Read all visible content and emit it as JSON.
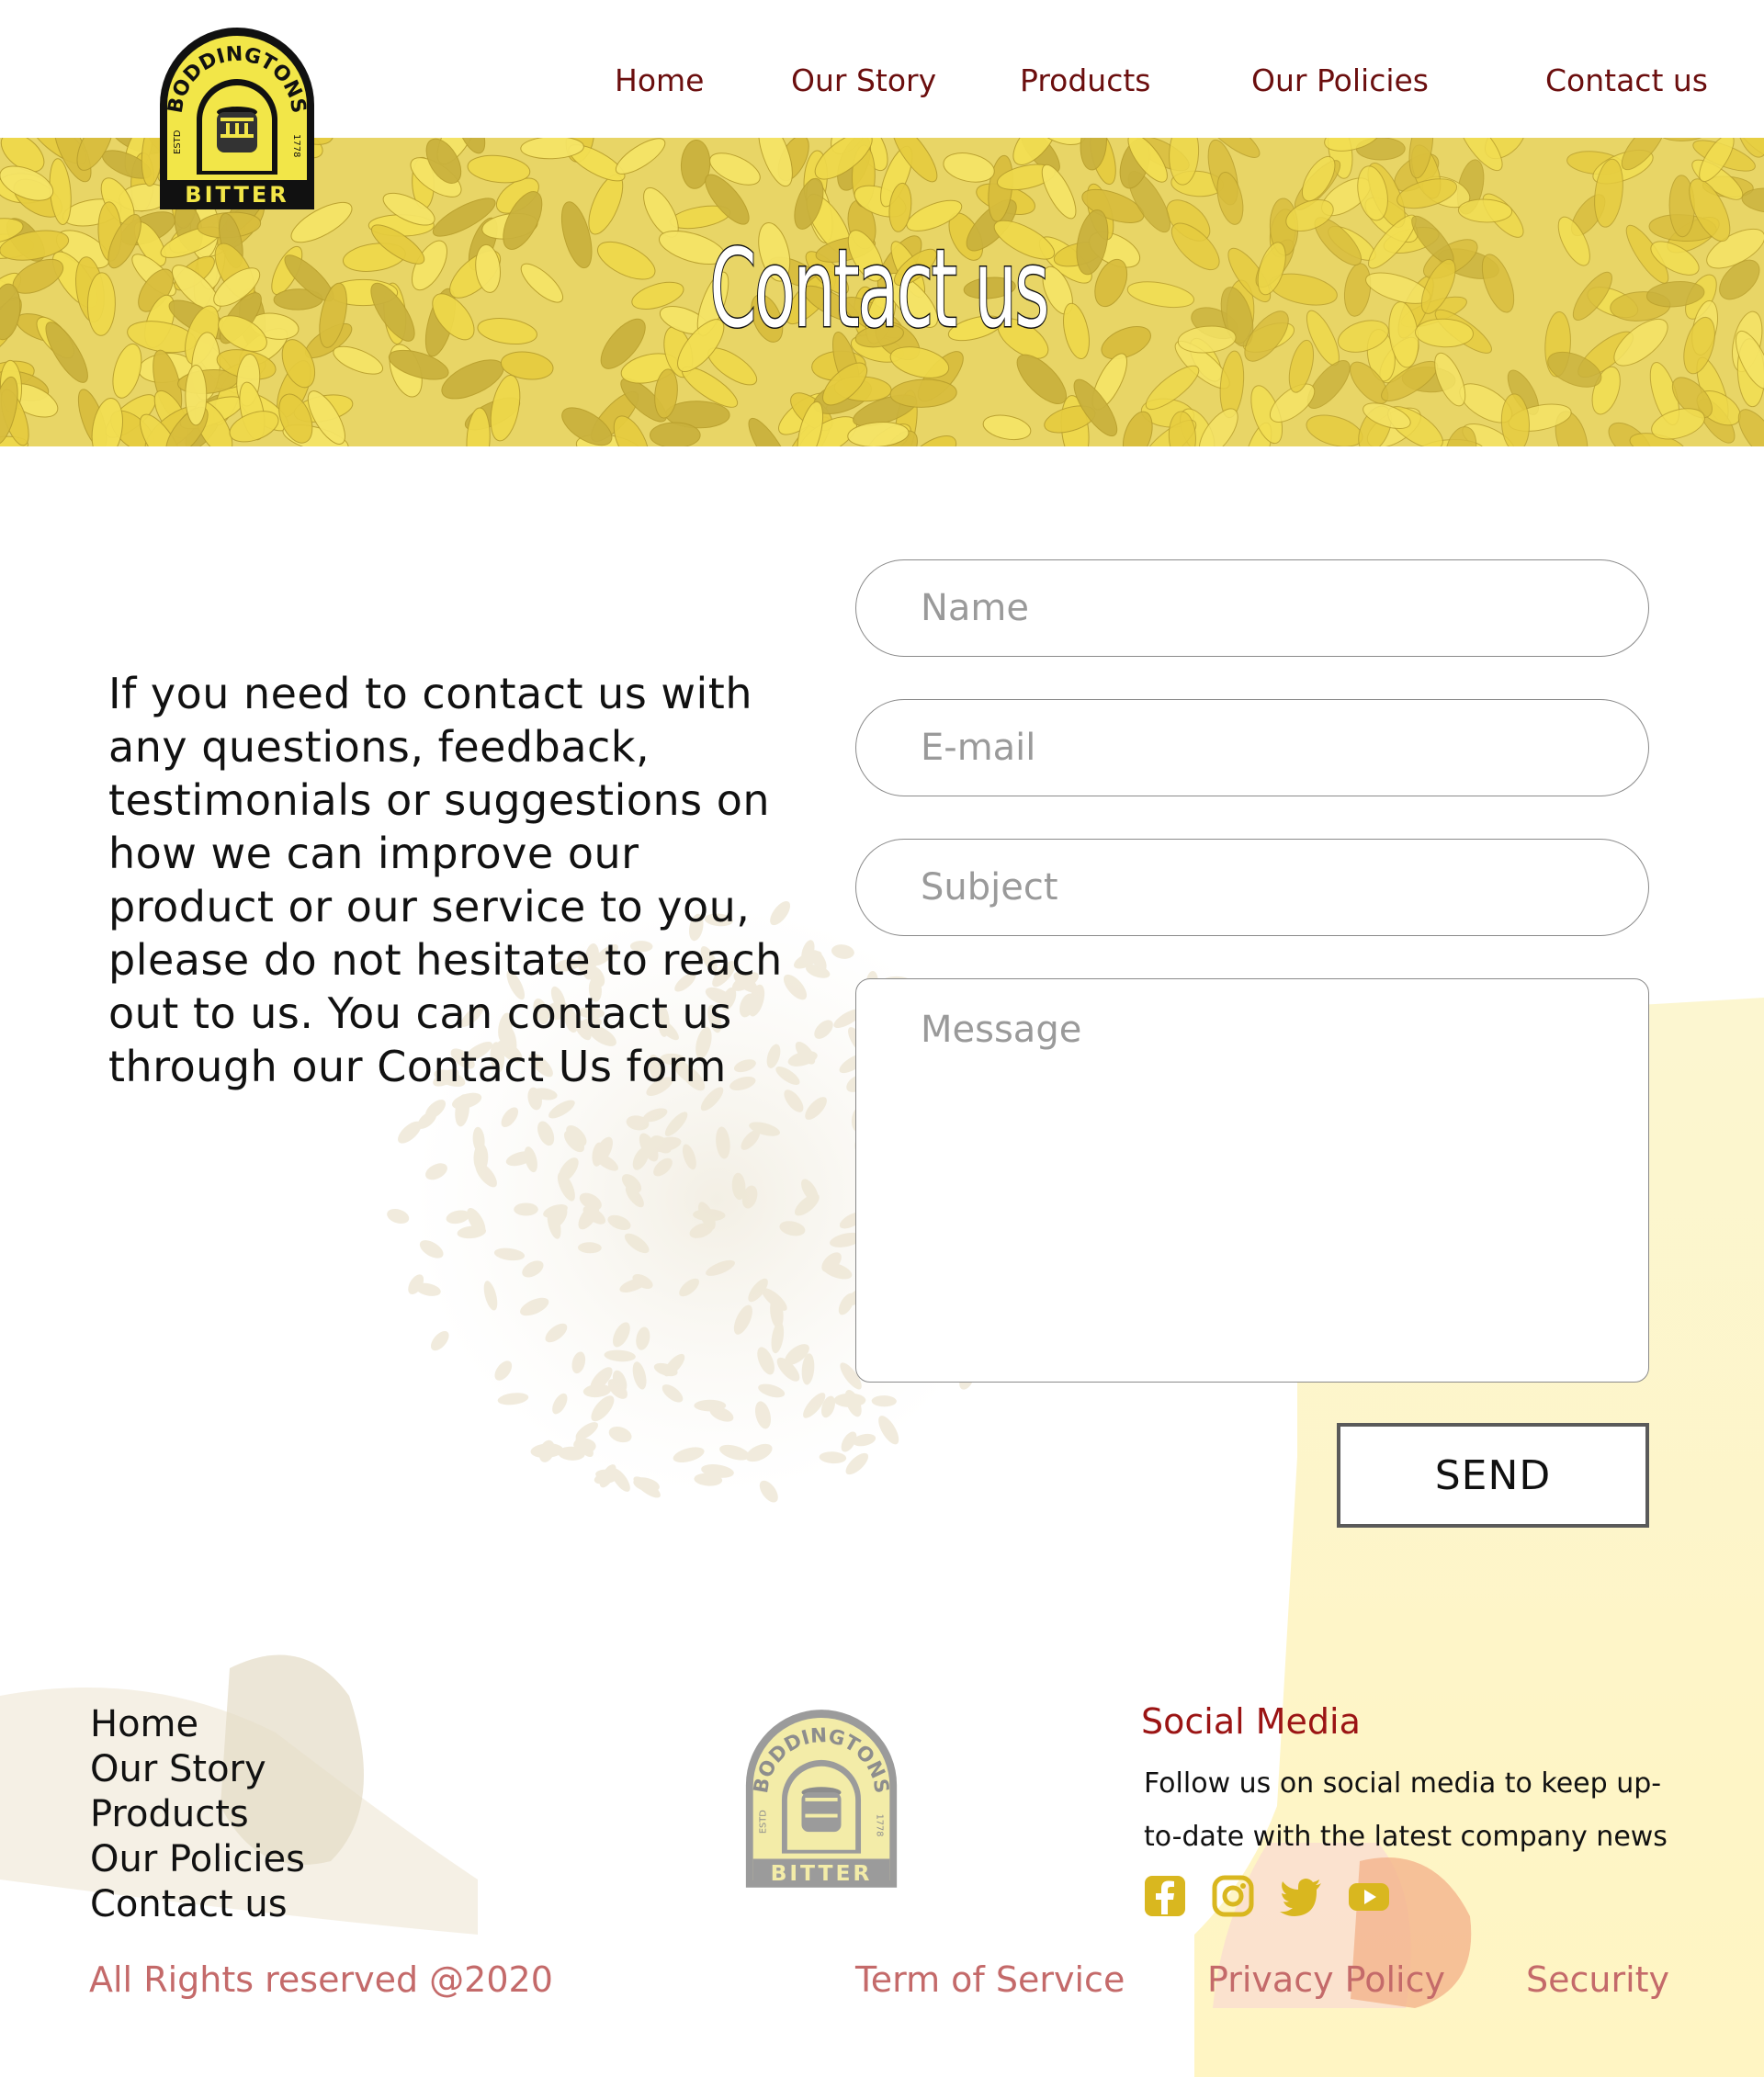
{
  "brand": {
    "logo_arc_text": "BODDINGTONS",
    "logo_bottom_text": "BITTER",
    "logo_left_text": "ESTD",
    "logo_right_text": "1778"
  },
  "nav": {
    "items": [
      {
        "label": "Home"
      },
      {
        "label": "Our Story"
      },
      {
        "label": "Products"
      },
      {
        "label": "Our Policies"
      },
      {
        "label": "Contact us"
      }
    ]
  },
  "hero": {
    "title": "Contact us"
  },
  "intro": {
    "text": "If you need to contact us with any questions, feedback, testimonials or suggestions on how we can improve our product or our service to you, please do not hesitate to reach out to us. You can contact us through our Contact Us form"
  },
  "form": {
    "name_placeholder": "Name",
    "email_placeholder": "E-mail",
    "subject_placeholder": "Subject",
    "message_placeholder": "Message",
    "send_label": "SEND"
  },
  "footer": {
    "links": [
      {
        "label": "Home"
      },
      {
        "label": "Our Story"
      },
      {
        "label": "Products"
      },
      {
        "label": "Our Policies"
      },
      {
        "label": "Contact us"
      }
    ],
    "social_title": "Social Media",
    "social_text": "Follow us on social media to keep up-to-date with the latest company news",
    "social_icons": [
      "facebook-icon",
      "instagram-icon",
      "twitter-icon",
      "youtube-icon"
    ],
    "copyright": "All Rights reserved @2020",
    "legal_links": [
      {
        "label": "Term of Service"
      },
      {
        "label": "Privacy Policy"
      },
      {
        "label": "Security"
      }
    ]
  },
  "colors": {
    "nav_text": "#6b0e0e",
    "hero_yellow": "#e8d566",
    "logo_yellow": "#f2e648",
    "social_title": "#9b1414",
    "social_icon": "#d9b71f",
    "legal_text": "#c46a6a"
  }
}
